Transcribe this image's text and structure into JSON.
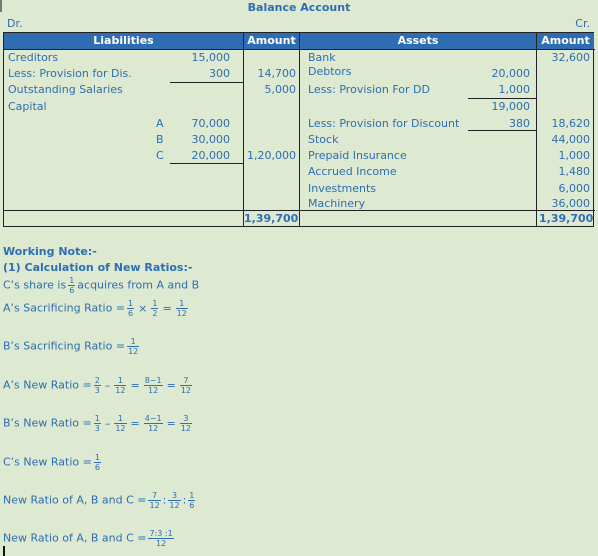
{
  "title": "Balance Account",
  "dr_label": "Dr.",
  "cr_label": "Cr.",
  "headers": {
    "liabilities": "Liabilities",
    "amount_left": "Amount",
    "assets": "Assets",
    "amount_right": "Amount"
  },
  "liabilities": {
    "creditors": {
      "label": "Creditors",
      "inner": "15,000"
    },
    "less_provision_dis": {
      "label": "Less: Provision for Dis.",
      "inner": "300",
      "amount": "14,700"
    },
    "outstanding_salaries": {
      "label": "Outstanding Salaries",
      "amount": "5,000"
    },
    "capital": {
      "label": "Capital"
    },
    "capital_a": {
      "partner": "A",
      "inner": "70,000"
    },
    "capital_b": {
      "partner": "B",
      "inner": "30,000"
    },
    "capital_c": {
      "partner": "C",
      "inner": "20,000",
      "amount": "1,20,000"
    },
    "total": "1,39,700"
  },
  "assets": {
    "bank": {
      "label": "Bank",
      "amount": "32,600"
    },
    "debtors": {
      "label": "Debtors",
      "inner": "20,000"
    },
    "less_provision_dd": {
      "label": "Less: Provision For DD",
      "inner": "1,000"
    },
    "debtors_net": {
      "inner": "19,000"
    },
    "less_provision_discount": {
      "label": "Less: Provision for Discount",
      "inner": "380",
      "amount": "18,620"
    },
    "stock": {
      "label": "Stock",
      "amount": "44,000"
    },
    "prepaid_insurance": {
      "label": "Prepaid Insurance",
      "amount": "1,000"
    },
    "accrued_income": {
      "label": "Accrued Income",
      "amount": "1,480"
    },
    "investments": {
      "label": "Investments",
      "amount": "6,000"
    },
    "machinery": {
      "label": "Machinery",
      "amount": "36,000"
    },
    "total": "1,39,700"
  },
  "working_note": {
    "heading": "Working Note:-",
    "subheading": "(1) Calculation  of New Ratios:-",
    "c_share": {
      "prefix": "C’s share is",
      "num": "1",
      "den": "6",
      "suffix": "acquires from A and B"
    },
    "a_sacrificing": {
      "label": "A’s Sacrificing Ratio =",
      "f1": [
        "1",
        "6"
      ],
      "op1": "×",
      "f2": [
        "1",
        "2"
      ],
      "eq": "=",
      "result": [
        "1",
        "12"
      ]
    },
    "b_sacrificing": {
      "label": "B’s Sacrificing Ratio =",
      "result": [
        "1",
        "12"
      ]
    },
    "a_new": {
      "label": "A’s New Ratio =",
      "f1": [
        "2",
        "3"
      ],
      "op1": "–",
      "f2": [
        "1",
        "12"
      ],
      "eq": "=",
      "f3": [
        "8−1",
        "12"
      ],
      "eq2": "=",
      "result": [
        "7",
        "12"
      ]
    },
    "b_new": {
      "label": "B’s New Ratio =",
      "f1": [
        "1",
        "3"
      ],
      "op1": "–",
      "f2": [
        "1",
        "12"
      ],
      "eq": "=",
      "f3": [
        "4−1",
        "12"
      ],
      "eq2": "=",
      "result": [
        "3",
        "12"
      ]
    },
    "c_new": {
      "label": "C’s New Ratio =",
      "result": [
        "1",
        "6"
      ]
    },
    "new_ratio_1": {
      "label": "New Ratio of A, B and C =",
      "f1": [
        "7",
        "12"
      ],
      "sep": ":",
      "f2": [
        "3",
        "12"
      ],
      "f3": [
        "1",
        "6"
      ]
    },
    "new_ratio_2": {
      "label": "New Ratio of A, B and C =",
      "result": [
        "7:3 :1",
        "12"
      ]
    }
  }
}
